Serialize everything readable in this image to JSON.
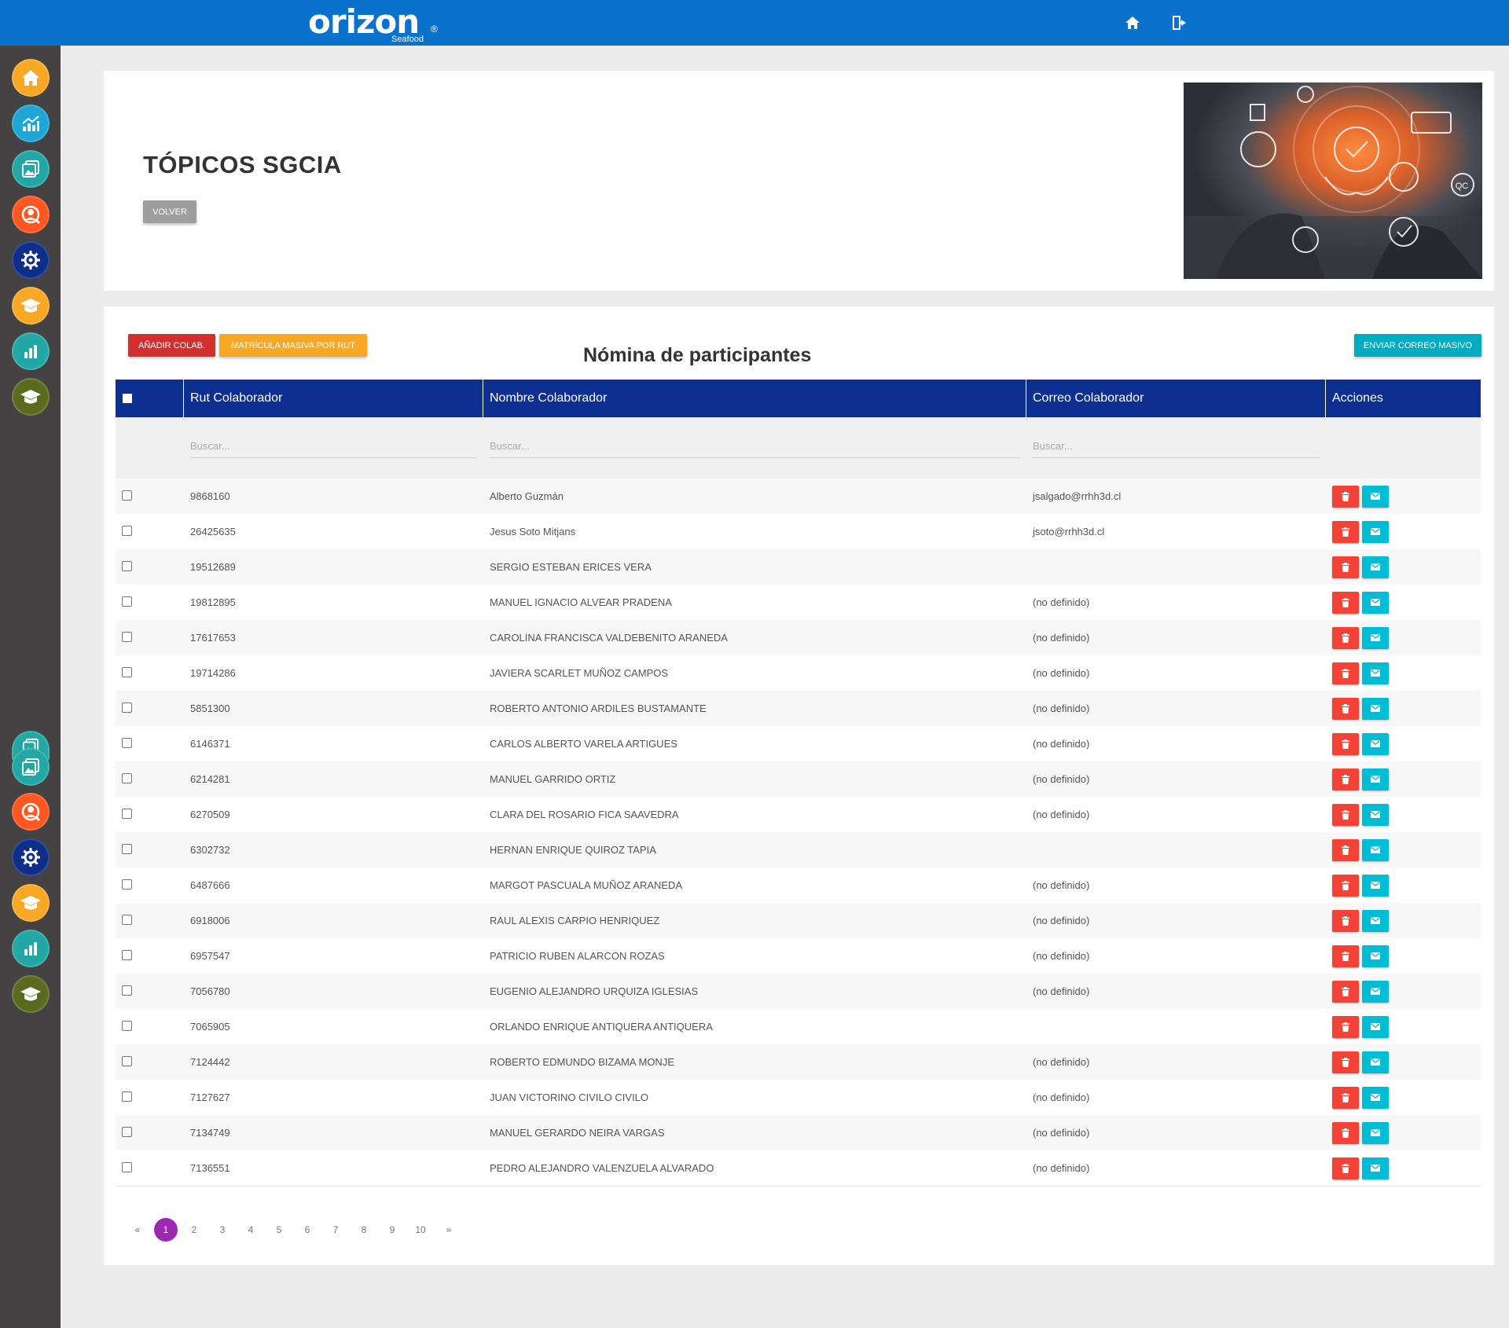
{
  "brand": {
    "name": "orizon",
    "registered": "®",
    "tagline": "Seafood"
  },
  "topbar": {
    "icons": [
      "home-icon",
      "logout-icon"
    ]
  },
  "sidebar": {
    "colors": [
      "#f9a825",
      "#1ea6d6",
      "#23a7a5",
      "#ff5722",
      "#0d2f8a",
      "#f9a825",
      "#23a7a5",
      "#5a6b1f",
      "#23a7a5",
      "#23a7a5",
      "#ff5722",
      "#0d2f8a",
      "#f9a825",
      "#23a7a5",
      "#5a6b1f"
    ],
    "icons": [
      "home-icon",
      "chart-icon",
      "gallery-icon",
      "search-user-icon",
      "settings-icon",
      "graduation-icon",
      "bar-chart-icon",
      "graduation-icon",
      "gallery-icon",
      "gallery-icon",
      "search-user-icon",
      "settings-icon",
      "graduation-icon",
      "bar-chart-icon",
      "graduation-icon"
    ]
  },
  "header": {
    "title": "TÓPICOS SGCIA",
    "back_label": "VOLVER"
  },
  "actions": {
    "add_label": "AÑADIR COLAB.",
    "bulk_enroll_label": "MATRÍCULA MASIVA POR RUT",
    "bulk_mail_label": "ENVIAR CORREO MASIVO"
  },
  "section_title": "Nómina de participantes",
  "table": {
    "headers": {
      "rut": "Rut Colaborador",
      "name": "Nombre Colaborador",
      "email": "Correo Colaborador",
      "actions": "Acciones"
    },
    "filter_placeholder": "Buscar...",
    "rows": [
      {
        "rut": "9868160",
        "name": "Alberto Guzmán",
        "email": "jsalgado@rrhh3d.cl"
      },
      {
        "rut": "26425635",
        "name": "Jesus Soto Mitjans",
        "email": "jsoto@rrhh3d.cl"
      },
      {
        "rut": "19512689",
        "name": "SERGIO ESTEBAN ERICES VERA",
        "email": ""
      },
      {
        "rut": "19812895",
        "name": "MANUEL IGNACIO ALVEAR PRADENA",
        "email": "(no definido)"
      },
      {
        "rut": "17617653",
        "name": "CAROLINA FRANCISCA VALDEBENITO ARANEDA",
        "email": "(no definido)"
      },
      {
        "rut": "19714286",
        "name": "JAVIERA SCARLET MUÑOZ CAMPOS",
        "email": "(no definido)"
      },
      {
        "rut": "5851300",
        "name": "ROBERTO ANTONIO ARDILES BUSTAMANTE",
        "email": "(no definido)"
      },
      {
        "rut": "6146371",
        "name": "CARLOS ALBERTO VARELA ARTIGUES",
        "email": "(no definido)"
      },
      {
        "rut": "6214281",
        "name": "MANUEL GARRIDO ORTIZ",
        "email": "(no definido)"
      },
      {
        "rut": "6270509",
        "name": "CLARA DEL ROSARIO FICA SAAVEDRA",
        "email": "(no definido)"
      },
      {
        "rut": "6302732",
        "name": "HERNAN ENRIQUE QUIROZ TAPIA",
        "email": ""
      },
      {
        "rut": "6487666",
        "name": "MARGOT PASCUALA MUÑOZ ARANEDA",
        "email": "(no definido)"
      },
      {
        "rut": "6918006",
        "name": "RAUL ALEXIS CARPIO HENRIQUEZ",
        "email": "(no definido)"
      },
      {
        "rut": "6957547",
        "name": "PATRICIO RUBEN ALARCON ROZAS",
        "email": "(no definido)"
      },
      {
        "rut": "7056780",
        "name": "EUGENIO ALEJANDRO URQUIZA IGLESIAS",
        "email": "(no definido)"
      },
      {
        "rut": "7065905",
        "name": "ORLANDO ENRIQUE ANTIQUERA ANTIQUERA",
        "email": ""
      },
      {
        "rut": "7124442",
        "name": "ROBERTO EDMUNDO BIZAMA MONJE",
        "email": "(no definido)"
      },
      {
        "rut": "7127627",
        "name": "JUAN VICTORINO CIVILO CIVILO",
        "email": "(no definido)"
      },
      {
        "rut": "7134749",
        "name": "MANUEL GERARDO NEIRA VARGAS",
        "email": "(no definido)"
      },
      {
        "rut": "7136551",
        "name": "PEDRO ALEJANDRO VALENZUELA ALVARADO",
        "email": "(no definido)"
      }
    ]
  },
  "pagination": {
    "prev": "«",
    "next": "»",
    "pages": [
      "1",
      "2",
      "3",
      "4",
      "5",
      "6",
      "7",
      "8",
      "9",
      "10"
    ],
    "current": "1"
  }
}
